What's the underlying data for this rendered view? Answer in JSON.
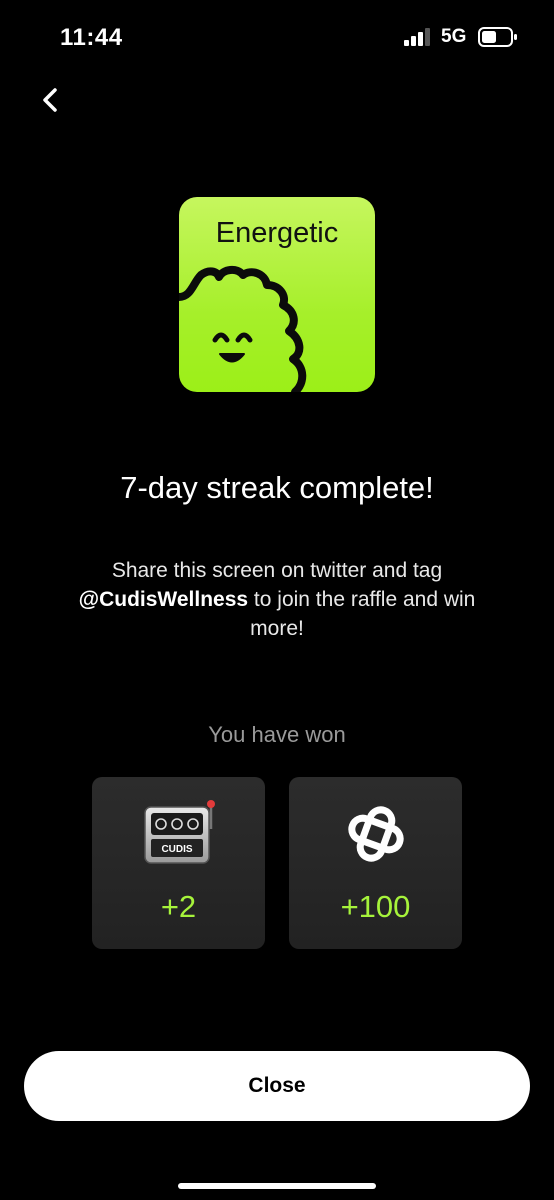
{
  "status_bar": {
    "time": "11:44",
    "network": "5G",
    "icons": [
      "signal-icon",
      "battery-icon"
    ]
  },
  "nav": {
    "back_icon": "chevron-left-icon"
  },
  "badge": {
    "title": "Energetic",
    "mascot_icon": "smiling-blob-mascot-icon",
    "colors": {
      "gradient_top": "#c6f65e",
      "gradient_bottom": "#9cef18",
      "ink": "#111111"
    }
  },
  "headline": "7-day streak complete!",
  "share": {
    "line_before": "Share this screen on twitter and tag ",
    "handle": "@CudisWellness",
    "line_after": " to join the raffle and win more!"
  },
  "rewards": {
    "heading": "You have won",
    "items": [
      {
        "icon": "cudis-slot-machine-icon",
        "icon_text": "CUDIS",
        "value": "+2"
      },
      {
        "icon": "cudis-points-logo-icon",
        "value": "+100"
      }
    ],
    "accent_color": "#a6f33b"
  },
  "close_label": "Close"
}
